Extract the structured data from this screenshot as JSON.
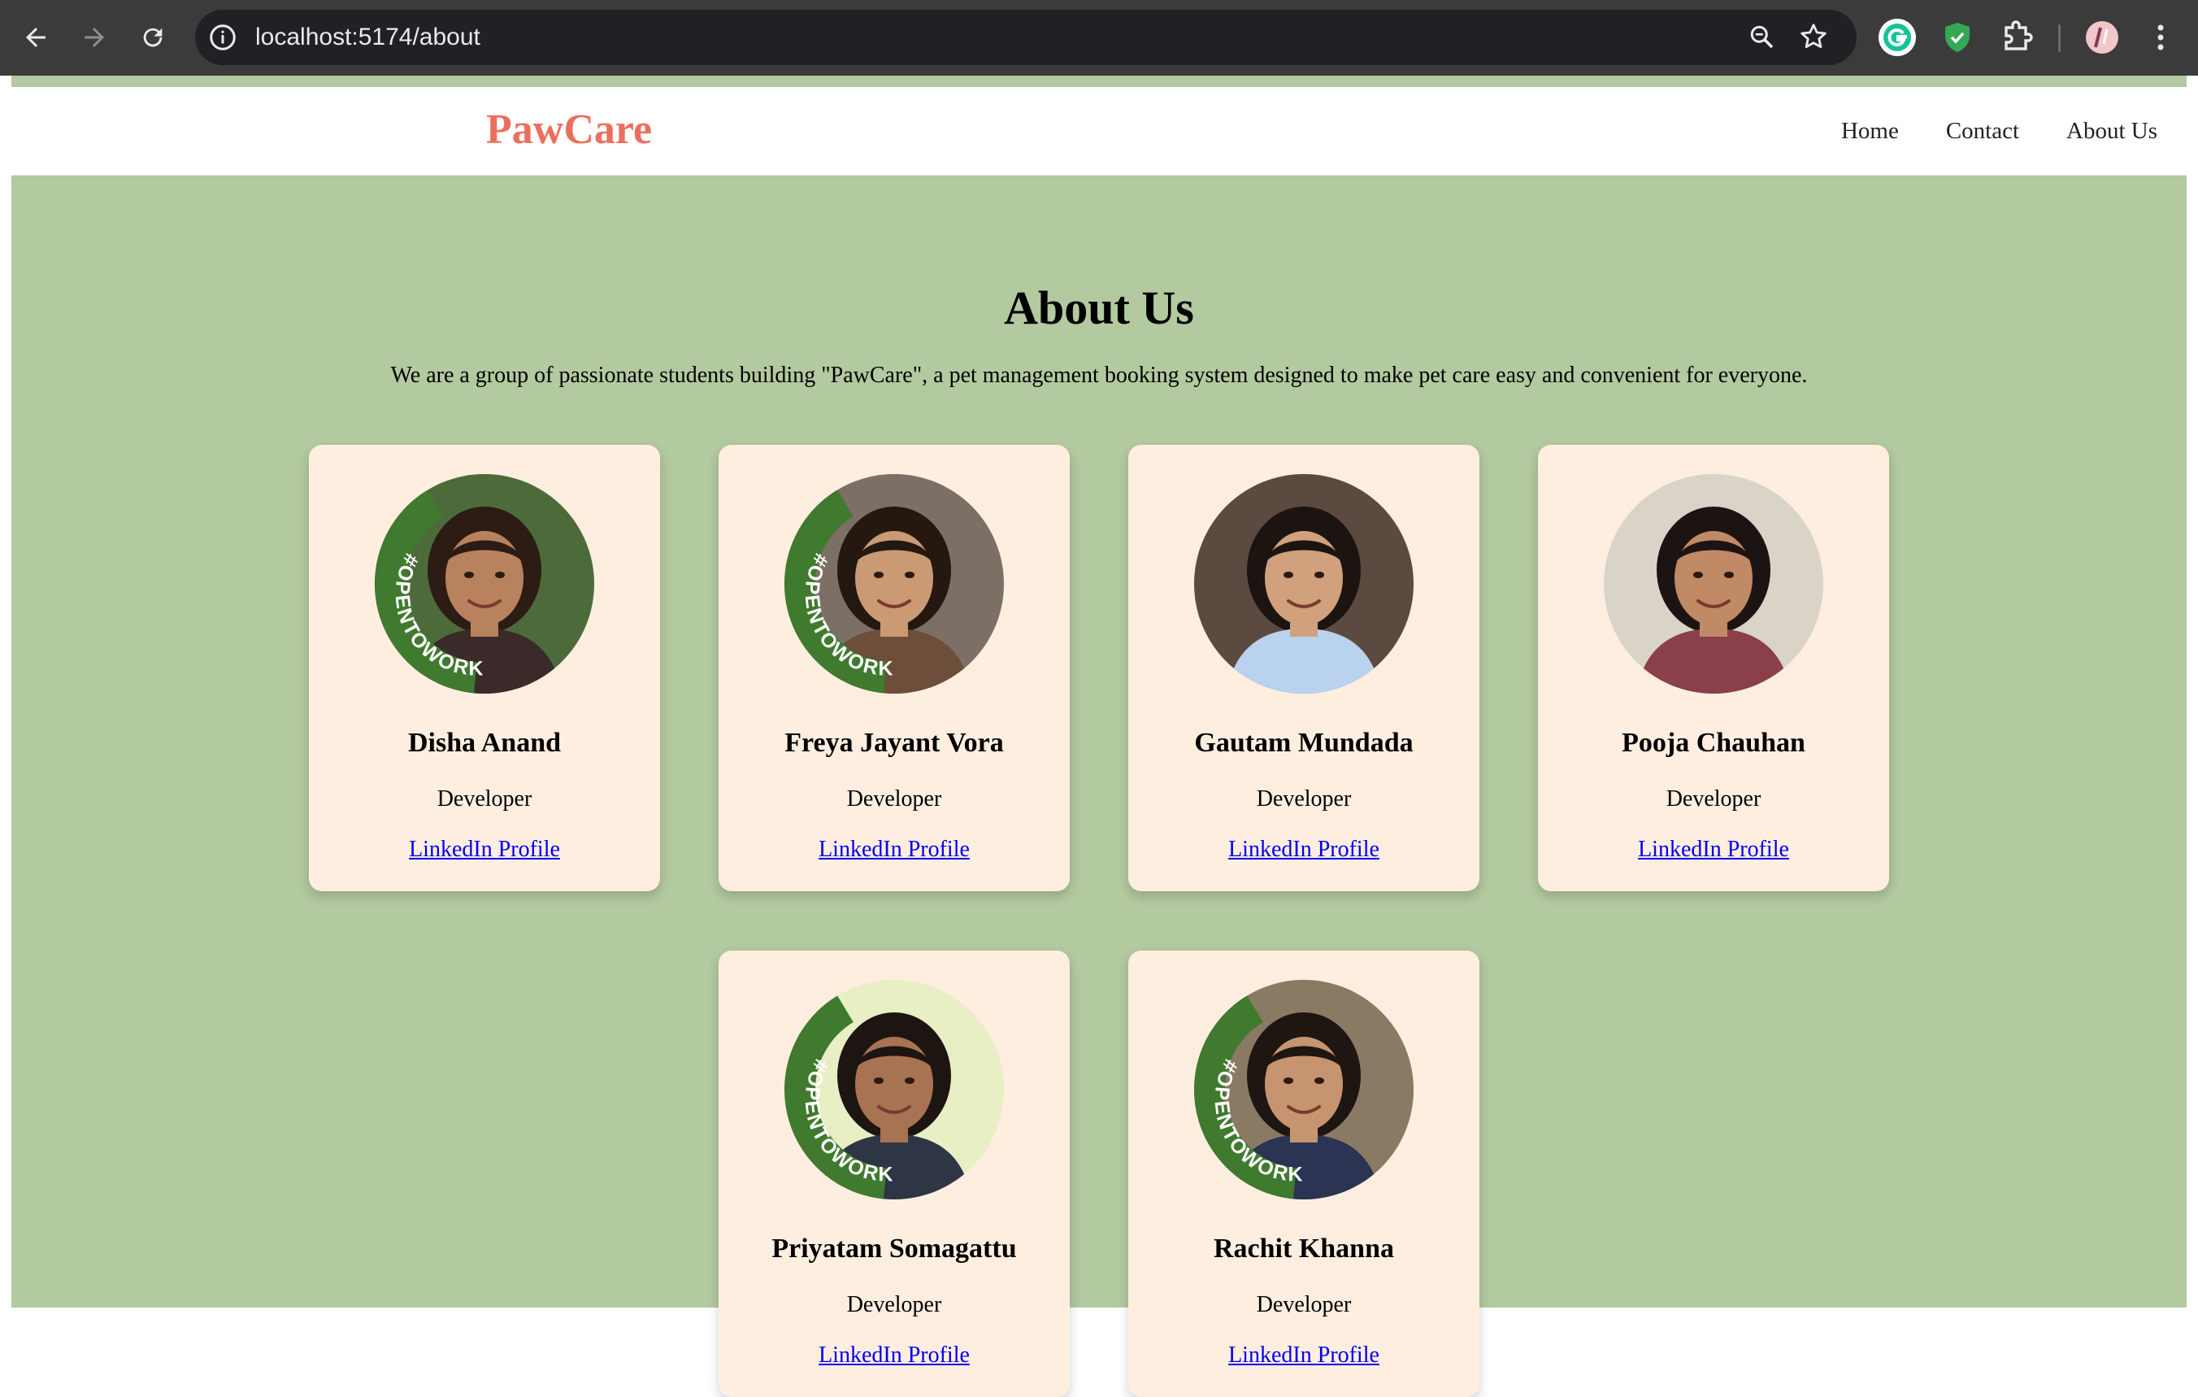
{
  "browser": {
    "url": "localhost:5174/about"
  },
  "site": {
    "logo": "PawCare",
    "nav": [
      "Home",
      "Contact",
      "About Us"
    ]
  },
  "about": {
    "title": "About Us",
    "intro": "We are a group of passionate students building \"PawCare\", a pet management booking system designed to make pet care easy and convenient for everyone."
  },
  "badge_text": "#OPENTOWORK",
  "team": [
    {
      "name": "Disha Anand",
      "role": "Developer",
      "link": "LinkedIn Profile"
    },
    {
      "name": "Freya Jayant Vora",
      "role": "Developer",
      "link": "LinkedIn Profile"
    },
    {
      "name": "Gautam Mundada",
      "role": "Developer",
      "link": "LinkedIn Profile"
    },
    {
      "name": "Pooja Chauhan",
      "role": "Developer",
      "link": "LinkedIn Profile"
    },
    {
      "name": "Priyatam Somagattu",
      "role": "Developer",
      "link": "LinkedIn Profile"
    },
    {
      "name": "Rachit Khanna",
      "role": "Developer",
      "link": "LinkedIn Profile"
    }
  ],
  "colors": {
    "page_bg": "#b3c99f",
    "card_bg": "#fdeee0",
    "brand": "#ec6f5d",
    "badge_green": "#3f7a2e"
  }
}
